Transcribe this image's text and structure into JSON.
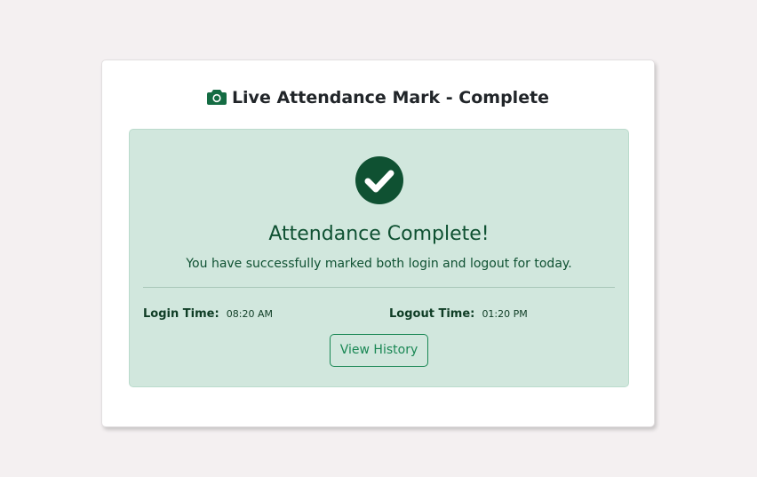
{
  "page": {
    "title": "Live Attendance Mark - Complete",
    "title_icon": "camera-icon"
  },
  "status": {
    "icon": "check-circle-icon",
    "heading": "Attendance Complete!",
    "message": "You have successfully marked both login and logout for today."
  },
  "times": {
    "login_label": "Login Time:",
    "login_value": "08:20 AM",
    "logout_label": "Logout Time:",
    "logout_value": "01:20 PM"
  },
  "actions": {
    "history_label": "View History"
  },
  "colors": {
    "success_dark": "#0f5132",
    "success_bg": "#d1e7dd",
    "success_border": "#badbcc",
    "button": "#198754",
    "icon": "#146c43"
  }
}
